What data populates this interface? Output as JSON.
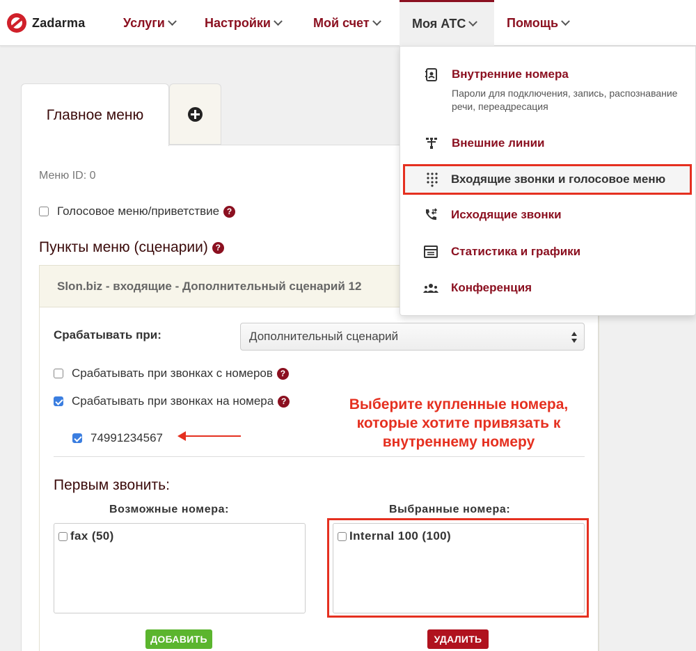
{
  "logo": {
    "text": "Zadarma"
  },
  "nav": [
    {
      "label": "Услуги"
    },
    {
      "label": "Настройки"
    },
    {
      "label": "Мой счет"
    },
    {
      "label": "Моя АТС"
    },
    {
      "label": "Помощь"
    }
  ],
  "tabs": {
    "main": "Главное меню"
  },
  "panel": {
    "menu_id": "Меню ID: 0",
    "voice_menu_label": "Голосовое меню/приветствие",
    "section_title": "Пункты меню (сценарии)",
    "scenario_title": "Slon.biz - входящие - Дополнительный сценарий 12",
    "trigger_label": "Срабатывать при:",
    "trigger_select": "Дополнительный сценарий",
    "from_numbers_label": "Срабатывать при звонках с номеров",
    "to_numbers_label": "Срабатывать при звонках на номера",
    "number_value": "74991234567",
    "first_call_title": "Первым звонить:",
    "available_label": "Возможные номера:",
    "selected_label": "Выбранные номера:",
    "available_items": [
      "fax (50)"
    ],
    "selected_items": [
      "Internal 100 (100)"
    ],
    "add_button": "ДОБАВИТЬ",
    "delete_button": "УДАЛИТЬ"
  },
  "annotation": {
    "line1": "Выберите купленные номера,",
    "line2": "которые хотите привязать к",
    "line3": "внутреннему номеру"
  },
  "dropdown": {
    "internal": {
      "title": "Внутренние номера",
      "sub": "Пароли для подключения, запись, распознавание речи, переадресация"
    },
    "external": {
      "title": "Внешние линии"
    },
    "incoming": {
      "title": "Входящие звонки и голосовое меню"
    },
    "outgoing": {
      "title": "Исходящие звонки"
    },
    "stats": {
      "title": "Статистика и графики"
    },
    "conference": {
      "title": "Конференция"
    }
  },
  "colors": {
    "brand": "#8b1020",
    "annotation": "#e53020",
    "add": "#5bb52e",
    "delete": "#b0121e",
    "checked": "#3b7ee0"
  }
}
